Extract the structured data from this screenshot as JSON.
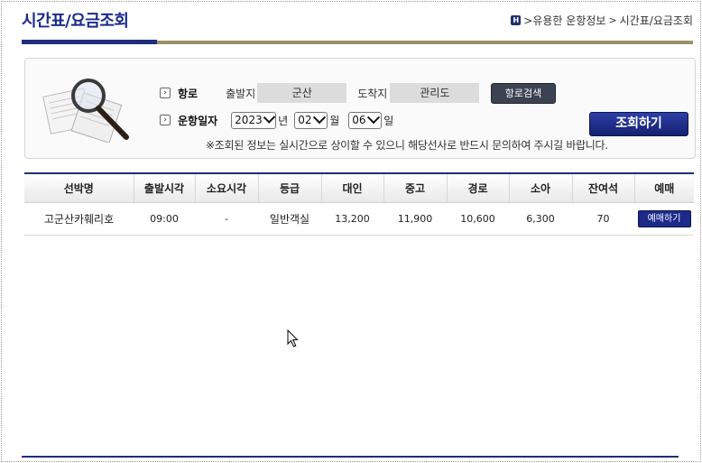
{
  "page": {
    "title": "시간표/요금조회",
    "breadcrumb": [
      ">유용한 운항정보",
      ">",
      "시간표/요금조회"
    ]
  },
  "search": {
    "route_label": "항로",
    "departure_label": "출발지",
    "departure_value": "군산",
    "arrival_label": "도착지",
    "arrival_value": "관리도",
    "route_search_button": "항로검색",
    "date_label": "운항일자",
    "year_value": "2023",
    "year_unit": "년",
    "month_value": "02",
    "month_unit": "월",
    "day_value": "06",
    "day_unit": "일",
    "query_button": "조회하기",
    "notice": "※조회된 정보는 실시간으로 상이할 수 있으니 해당선사로 반드시 문의하여 주시길 바랍니다."
  },
  "table": {
    "headers": [
      "선박명",
      "출발시각",
      "소요시각",
      "등급",
      "대인",
      "중고",
      "경로",
      "소아",
      "잔여석",
      "예매"
    ],
    "rows": [
      {
        "ship": "고군산카훼리호",
        "departure_time": "09:00",
        "duration": "-",
        "grade": "일반객실",
        "adult": "13,200",
        "teen": "11,900",
        "senior": "10,600",
        "child": "6,300",
        "remaining": "70",
        "reserve_label": "예매하기"
      }
    ]
  },
  "colors": {
    "accent_navy": "#1f2d7a",
    "accent_tan": "#9c8f6c"
  }
}
